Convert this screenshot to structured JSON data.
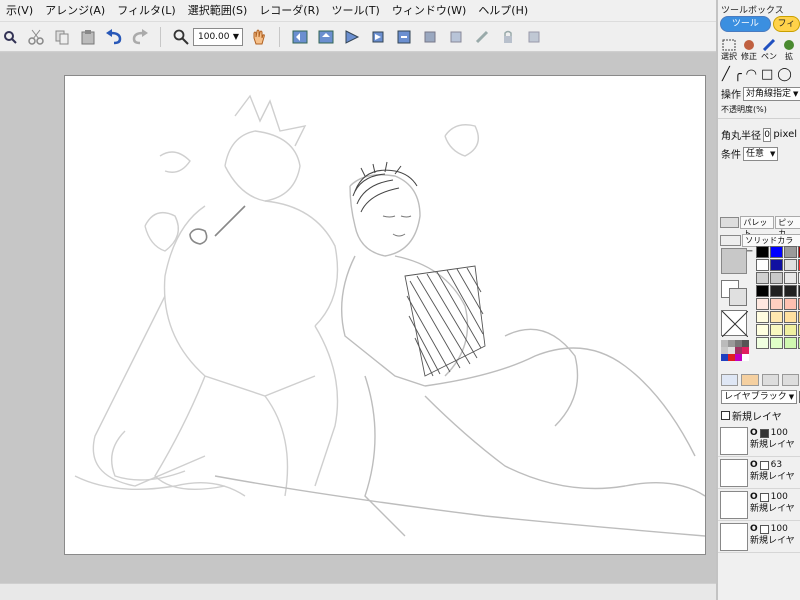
{
  "menubar": {
    "items": [
      "示(V)",
      "アレンジ(A)",
      "フィルタ(L)",
      "選択範囲(S)",
      "レコーダ(R)",
      "ツール(T)",
      "ウィンドウ(W)",
      "ヘルプ(H)"
    ]
  },
  "toolbar": {
    "zoom_value": "100.00",
    "icons": [
      "zoom-icon",
      "cut-icon",
      "copy-icon",
      "paste-icon",
      "undo-icon",
      "redo-icon",
      "hand-icon"
    ]
  },
  "toolbox": {
    "title": "ツールボックス",
    "tabs": [
      {
        "label": "ツール"
      },
      {
        "label": "フィ"
      }
    ],
    "tool_labels": [
      "選択",
      "修正",
      "ペン",
      "拡"
    ],
    "operation_label": "操作",
    "operation_value": "対角線指定",
    "opacity_label": "不透明度(%)",
    "radius_label": "角丸半径",
    "radius_value": "0",
    "radius_unit": "pixel",
    "condition_label": "条件",
    "condition_value": "任意"
  },
  "palette": {
    "tabs": [
      "パレット",
      "ピッカ"
    ],
    "set_label": "ソリッドカラー",
    "swatches": [
      "#000000",
      "#0000ff",
      "#9a9a9a",
      "#aa0000",
      "#ffffff",
      "#1010a0",
      "#e0e0e0",
      "#ff3030",
      "#d0d0d0",
      "#c8c8c8",
      "#e8e8e8",
      "#f0f0f0",
      "#000000",
      "#202020",
      "#202020",
      "#202020",
      "#ffe8e0",
      "#ffd0c0",
      "#ffc0b0",
      "#f0a090",
      "#fffce0",
      "#ffe8b0",
      "#ffe0a0",
      "#f0d080",
      "#ffffe0",
      "#f8f8c0",
      "#f0f0a0",
      "#e8e890",
      "#f0ffe0",
      "#e0ffc8",
      "#d0f8b0",
      "#c0f0a0"
    ]
  },
  "layers": {
    "mode_label": "レイヤブラック",
    "new_layer_label": "新規レイヤ",
    "items": [
      {
        "opacity": "100",
        "name": "新規レイヤ"
      },
      {
        "opacity": "63",
        "name": "新規レイヤ"
      },
      {
        "opacity": "100",
        "name": "新規レイヤ"
      },
      {
        "opacity": "100",
        "name": "新規レイヤ"
      }
    ]
  },
  "colors": {
    "tool_tab_active": "#3b8fe0",
    "tool_tab_inactive": "#ffd24a",
    "workspace": "#c6c6c6"
  }
}
